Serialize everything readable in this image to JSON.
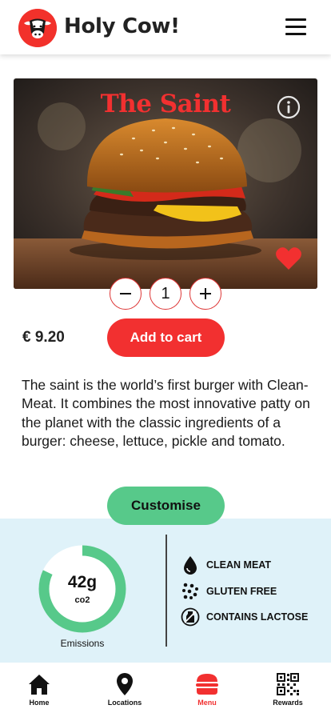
{
  "header": {
    "brand": "Holy Cow!",
    "logo_icon": "cow-head-icon",
    "menu_icon": "hamburger-menu-icon"
  },
  "product": {
    "title": "The Saint",
    "price": "€ 9.20",
    "quantity": "1",
    "description": "The saint is the world’s first burger with Clean-Meat. It combines the most innovative patty on the planet with the classic ingredients of a burger: cheese, lettuce, pickle and tomato.",
    "favorite": true
  },
  "actions": {
    "add_to_cart": "Add to cart",
    "customise": "Customise"
  },
  "emissions": {
    "value": "42g",
    "unit": "co2",
    "label": "Emissions",
    "fill_fraction": 0.82
  },
  "attributes": [
    {
      "icon": "drop-icon",
      "label": "CLEAN MEAT"
    },
    {
      "icon": "dots-icon",
      "label": "GLUTEN FREE"
    },
    {
      "icon": "no-milk-icon",
      "label": "CONTAINS LACTOSE"
    }
  ],
  "nav": [
    {
      "icon": "home-icon",
      "label": "Home",
      "active": false
    },
    {
      "icon": "location-pin-icon",
      "label": "Locations",
      "active": false
    },
    {
      "icon": "burger-icon",
      "label": "Menu",
      "active": true
    },
    {
      "icon": "qr-code-icon",
      "label": "Rewards",
      "active": false
    }
  ],
  "colors": {
    "accent": "#f23030",
    "green": "#57c98a",
    "panel": "#dff2f9"
  }
}
